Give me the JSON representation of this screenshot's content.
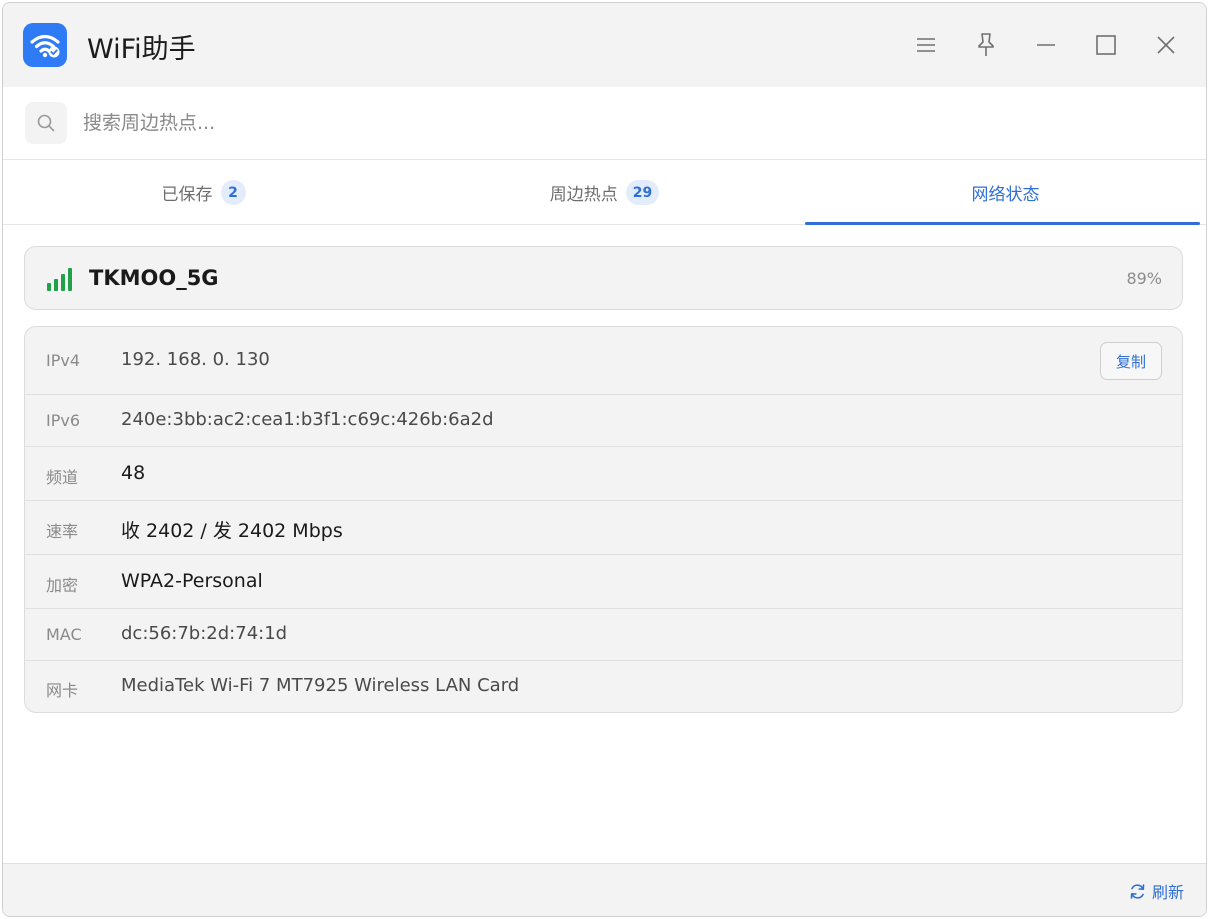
{
  "app": {
    "title": "WiFi助手",
    "icon": "wifi-check-icon"
  },
  "window_controls": [
    "menu-icon",
    "pin-icon",
    "minimize-icon",
    "maximize-icon",
    "close-icon"
  ],
  "search": {
    "placeholder": "搜索周边热点...",
    "value": ""
  },
  "tabs": [
    {
      "label": "已保存",
      "badge": "2",
      "active": false
    },
    {
      "label": "周边热点",
      "badge": "29",
      "active": false
    },
    {
      "label": "网络状态",
      "active": true
    }
  ],
  "network": {
    "ssid": "TKMOO_5G",
    "strength": "89%",
    "signal_icon": "signal-bars-icon"
  },
  "details": [
    {
      "key": "IPv4",
      "value": "192. 168. 0. 130"
    },
    {
      "key": "IPv6",
      "value": "240e:3bb:ac2:cea1:b3f1:c69c:426b:6a2d"
    },
    {
      "key": "频道",
      "value": "48"
    },
    {
      "key": "速率",
      "value": "收 2402 / 发 2402 Mbps"
    },
    {
      "key": "加密",
      "value": "WPA2-Personal"
    },
    {
      "key": "MAC",
      "value": "dc:56:7b:2d:74:1d"
    },
    {
      "key": "网卡",
      "value": "MediaTek Wi-Fi 7 MT7925 Wireless LAN Card"
    }
  ],
  "copy_label": "复制",
  "footer": {
    "refresh_label": "刷新"
  },
  "colors": {
    "accent": "#2f6fd6",
    "signal": "#22a04a",
    "app_icon_bg": "#2f7bf5"
  }
}
